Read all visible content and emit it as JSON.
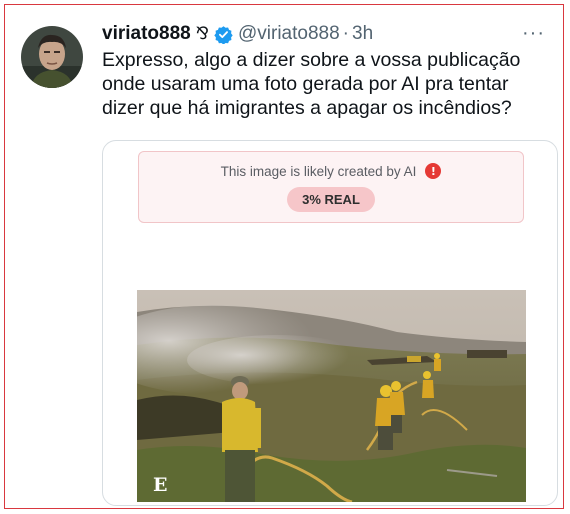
{
  "tweet": {
    "display_name": "viriato888",
    "name_glyph": "⅋",
    "handle": "@viriato888",
    "separator": "·",
    "time": "3h",
    "more_label": "···",
    "text": "Expresso, algo a dizer sobre a vossa publicação onde usaram uma foto gerada por AI pra tentar dizer que há imigrantes a apagar os incêndios?",
    "avatar_icon": "profile-photo-avatar",
    "verified_icon": "verified-badge-icon"
  },
  "quoted_media": {
    "ai_notice": "This image is likely created by AI",
    "ai_warning_glyph": "!",
    "real_score": "3% REAL",
    "photo_watermark": "E",
    "colors": {
      "notice_bg": "#fdf3f4",
      "notice_border": "#f1c5c8",
      "pill_bg": "#f6c6c9",
      "warning": "#e53935",
      "verified": "#1d9bf0",
      "frame": "#d9383f"
    }
  }
}
